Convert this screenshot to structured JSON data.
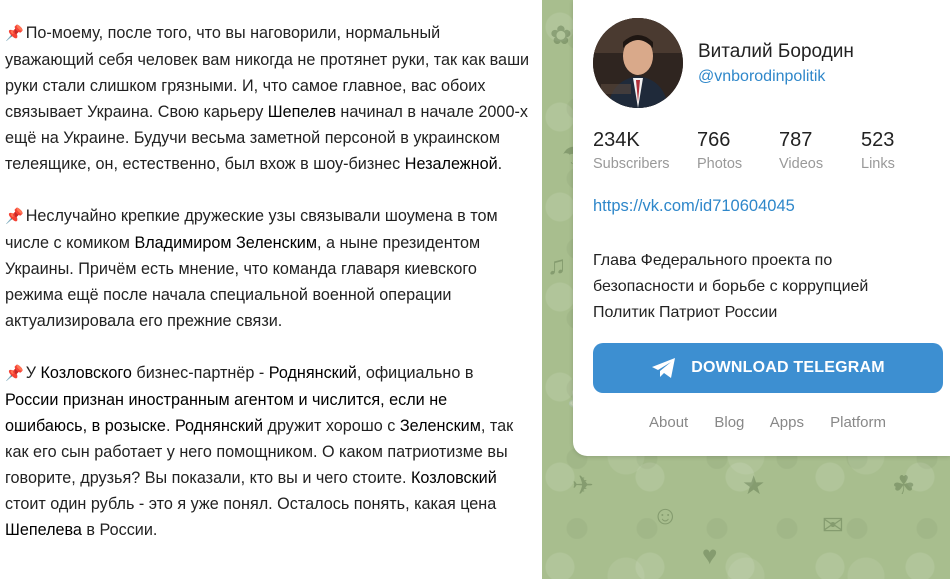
{
  "post": {
    "paragraphs": [
      [
        {
          "t": "По-моему, после того, что вы наговорили, нормальный уважающий себя человек вам никогда не протянет руки, так как ваши руки стали слишком грязными. И, что самое главное, вас обоих связывает Украина. Свою карьеру "
        },
        {
          "t": "Шепелев",
          "b": true
        },
        {
          "t": " начинал в начале 2000-х ещё на Украине. Будучи весьма заметной персоной в украинском телеящике, он, естественно, был вхож в шоу-бизнес "
        },
        {
          "t": "Незалежной",
          "b": true
        },
        {
          "t": "."
        }
      ],
      [
        {
          "t": "Неслучайно крепкие дружеские узы связывали шоумена в том числе с комиком "
        },
        {
          "t": "Владимиром Зеленским",
          "b": true
        },
        {
          "t": ", а ныне президентом Украины. Причём есть мнение, что команда главаря киевского режима ещё после начала специальной военной операции актуализировала его прежние связи."
        }
      ],
      [
        {
          "t": "У "
        },
        {
          "t": "Козловского",
          "b": true
        },
        {
          "t": " бизнес-партнёр - "
        },
        {
          "t": "Роднянский",
          "b": true
        },
        {
          "t": ", официально в "
        },
        {
          "t": "России признан иностранным агентом и числится, если не ошибаюсь, в розыске",
          "b": true
        },
        {
          "t": ". "
        },
        {
          "t": "Роднянский",
          "b": true
        },
        {
          "t": " дружит хорошо с "
        },
        {
          "t": "Зеленским",
          "b": true
        },
        {
          "t": ", так как его сын работает у него помощником. О каком патриотизме вы говорите, друзья? Вы показали, кто вы и чего стоите. "
        },
        {
          "t": "Козловский",
          "b": true
        },
        {
          "t": " стоит один рубль - это я уже понял. Осталось понять, какая цена "
        },
        {
          "t": "Шепелева",
          "b": true
        },
        {
          "t": " в России."
        }
      ]
    ],
    "bullet_icon": "pushpin-icon"
  },
  "channel": {
    "name": "Виталий Бородин",
    "handle": "@vnborodinpolitik",
    "stats": [
      {
        "value": "234K",
        "label": "Subscribers"
      },
      {
        "value": "766",
        "label": "Photos"
      },
      {
        "value": "787",
        "label": "Videos"
      },
      {
        "value": "523",
        "label": "Links"
      }
    ],
    "link": "https://vk.com/id710604045",
    "bio_lines": [
      "Глава Федерального проекта по",
      "безопасности и борьбе с коррупцией",
      "Политик Патриот России"
    ],
    "download_label": "DOWNLOAD TELEGRAM",
    "footer_links": [
      "About",
      "Blog",
      "Apps",
      "Platform"
    ]
  },
  "colors": {
    "accent_link": "#2e87ca",
    "button": "#3d8fd1",
    "sidebar_bg": "#a8be8e",
    "pin": "#d9534f"
  }
}
